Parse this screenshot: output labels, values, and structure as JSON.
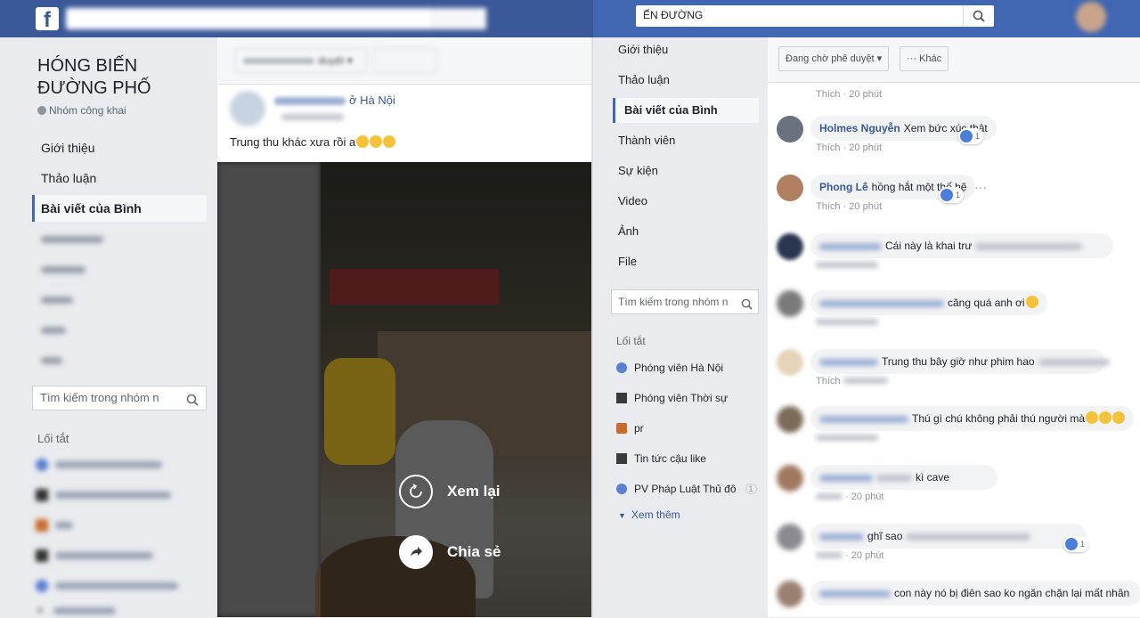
{
  "left_window": {
    "logo": "f",
    "group": {
      "name": "HÓNG BIẾN ĐƯỜNG PHỐ",
      "privacy": "Nhóm công khai"
    },
    "nav": [
      {
        "label": "Giới thiệu"
      },
      {
        "label": "Thảo luận"
      },
      {
        "label": "Bài viết của Bình"
      }
    ],
    "search_placeholder": "Tìm kiếm trong nhóm n",
    "shortcuts_title": "Lối tắt",
    "feed": {
      "filter_label": "duyệt",
      "post": {
        "location": "ở Hà Nội",
        "text": "Trung thu khác xưa rồi a"
      },
      "video_actions": {
        "replay": "Xem lại",
        "share": "Chia sẻ"
      }
    }
  },
  "right_window": {
    "search_value": "ẾN ĐƯỜNG",
    "nav": [
      {
        "label": "Giới thiệu"
      },
      {
        "label": "Thảo luận"
      },
      {
        "label": "Bài viết của Bình"
      },
      {
        "label": "Thành viên"
      },
      {
        "label": "Sự kiện"
      },
      {
        "label": "Video"
      },
      {
        "label": "Ảnh"
      },
      {
        "label": "File"
      }
    ],
    "search_placeholder": "Tìm kiếm trong nhóm n",
    "shortcuts_title": "Lối tắt",
    "shortcuts": [
      {
        "label": "Phóng viên Hà Nội",
        "icon": "globe-icon"
      },
      {
        "label": "Phóng viên Thời sự",
        "icon": "page-icon"
      },
      {
        "label": "pr",
        "icon": "image-icon"
      },
      {
        "label": "Tin tức cậu like",
        "icon": "page-icon"
      },
      {
        "label": "PV Pháp Luật Thủ đô",
        "icon": "globe-icon",
        "badge": "1"
      }
    ],
    "see_more": "Xem thêm",
    "comments_header": {
      "pending": "Đang chờ phê duyệt",
      "more": "Khác"
    },
    "comments": [
      {
        "name": "",
        "text": "",
        "time": "20 phút",
        "like": "Thích"
      },
      {
        "name": "Holmes Nguyễn",
        "text": "Xem bức xúc thật",
        "time": "20 phút",
        "like": "Thích",
        "reactions": "1"
      },
      {
        "name": "Phong Lê",
        "text": "hồng hắt một thế hệ",
        "time": "20 phút",
        "like": "Thích",
        "reactions": "1"
      },
      {
        "name": "",
        "text": "Cái này là khai trư",
        "time": "",
        "like": ""
      },
      {
        "name": "",
        "text": "căng quá anh ơi",
        "time": "",
        "like": ""
      },
      {
        "name": "",
        "text": "Trung thu bây giờ như phim hao",
        "time": "",
        "like": "Thích"
      },
      {
        "name": "",
        "text": "Thú gì chú không phải thú người mà",
        "time": "",
        "like": ""
      },
      {
        "name": "",
        "text": "kì cave",
        "time": "20 phút",
        "like": ""
      },
      {
        "name": "",
        "text": "ghĩ sao",
        "time": "20 phút",
        "like": "",
        "reactions": "1"
      },
      {
        "name": "",
        "text": "con này nó bị điên sao ko ngăn chặn lại mất nhân",
        "time": "",
        "like": ""
      }
    ]
  },
  "colors": {
    "facebook_blue": "#3b5998",
    "link_blue": "#385898",
    "active_bar": "#4267b2",
    "background": "#e9ebee"
  }
}
